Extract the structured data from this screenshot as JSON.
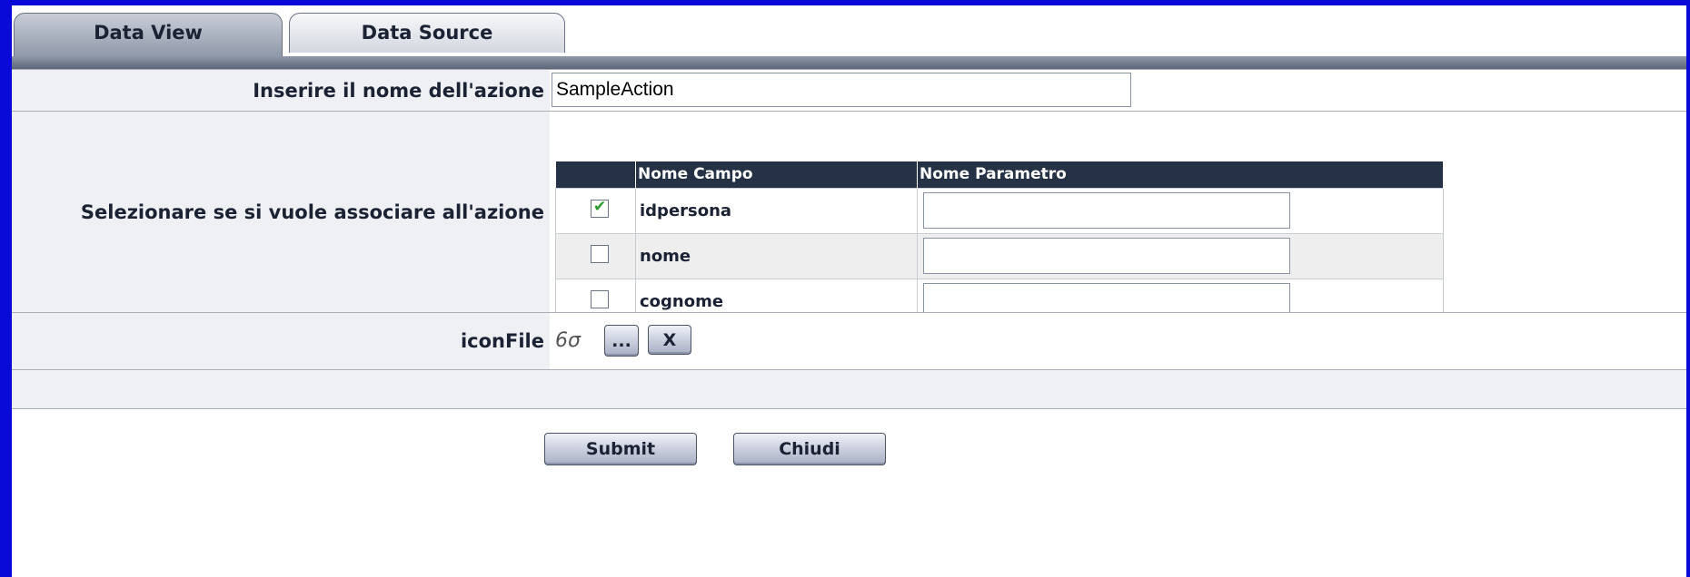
{
  "tabs": [
    {
      "label": "Data View",
      "active": true
    },
    {
      "label": "Data Source",
      "active": false
    }
  ],
  "form": {
    "action_name_label": "Inserire il nome dell'azione",
    "action_name_value": "SampleAction",
    "associate_label": "Selezionare se si vuole associare all'azione",
    "icon_file_label": "iconFile",
    "browse_button": "...",
    "clear_button": "X"
  },
  "fields_table": {
    "headers": [
      "",
      "Nome Campo",
      "Nome Parametro"
    ],
    "rows": [
      {
        "checked": true,
        "field": "idpersona",
        "param": ""
      },
      {
        "checked": false,
        "field": "nome",
        "param": ""
      },
      {
        "checked": false,
        "field": "cognome",
        "param": ""
      }
    ]
  },
  "actions": {
    "submit": "Submit",
    "close": "Chiudi"
  },
  "icons": {
    "preview": "glasses-icon"
  },
  "colors": {
    "background_border": "#0a0ad8",
    "table_header": "#253245",
    "tab_bar": "#5c667a",
    "check": "#2a9b2a"
  }
}
